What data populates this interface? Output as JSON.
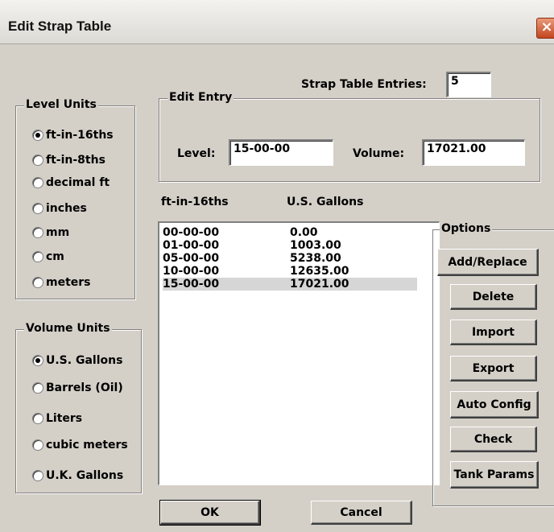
{
  "window": {
    "title": "Edit Strap Table",
    "close_glyph": "×"
  },
  "entries": {
    "label": "Strap Table Entries:",
    "value": "5"
  },
  "edit_entry": {
    "legend": "Edit Entry",
    "level_label": "Level:",
    "level_value": "15-00-00",
    "volume_label": "Volume:",
    "volume_value": "17021.00"
  },
  "level_units": {
    "legend": "Level Units",
    "options": [
      "ft-in-16ths",
      "ft-in-8ths",
      "decimal ft",
      "inches",
      "mm",
      "cm",
      "meters"
    ],
    "selected_index": 0
  },
  "volume_units": {
    "legend": "Volume Units",
    "options": [
      "U.S. Gallons",
      "Barrels (Oil)",
      "Liters",
      "cubic meters",
      "U.K. Gallons"
    ],
    "selected_index": 0
  },
  "table": {
    "headers": [
      "ft-in-16ths",
      "U.S. Gallons"
    ],
    "rows": [
      [
        "00-00-00",
        "0.00"
      ],
      [
        "01-00-00",
        "1003.00"
      ],
      [
        "05-00-00",
        "5238.00"
      ],
      [
        "10-00-00",
        "12635.00"
      ],
      [
        "15-00-00",
        "17021.00"
      ]
    ],
    "selected_index": 4
  },
  "options": {
    "legend": "Options",
    "buttons": [
      "Add/Replace",
      "Delete",
      "Import",
      "Export",
      "Auto Config",
      "Check",
      "Tank Params"
    ]
  },
  "footer": {
    "ok": "OK",
    "cancel": "Cancel"
  },
  "colors": {
    "face": "#d4d0c8",
    "selected_row": "#d6d6d6",
    "close": "#c4461f"
  }
}
